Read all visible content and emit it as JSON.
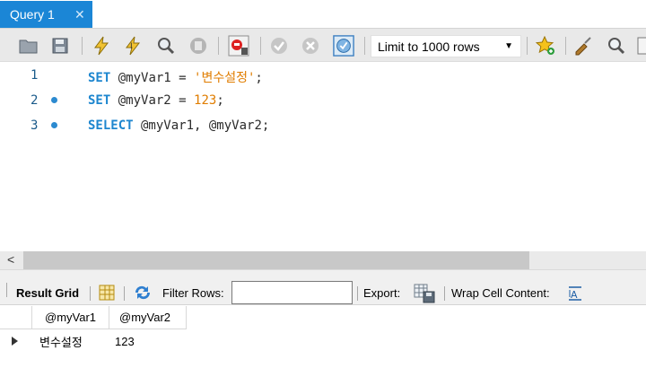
{
  "tab": {
    "title": "Query 1",
    "close_glyph": "✕"
  },
  "toolbar": {
    "icons": [
      "open-folder-icon",
      "save-icon",
      "execute-icon",
      "execute-current-icon",
      "explain-icon",
      "stop-icon",
      "toggle-error-icon",
      "commit-icon",
      "rollback-icon",
      "autocommit-icon",
      "bookmark-icon",
      "beautify-icon",
      "find-icon"
    ],
    "limit_label": "Limit to 1000 rows"
  },
  "editor": {
    "lines": [
      {
        "number": "1",
        "has_dot": false,
        "kw": "SET",
        "rest_var": " @myVar1 = ",
        "str": "'변수설정'",
        "end": ";"
      },
      {
        "number": "2",
        "has_dot": true,
        "kw": "SET",
        "rest_var": " @myVar2 = ",
        "num": "123",
        "end": ";"
      },
      {
        "number": "3",
        "has_dot": true,
        "kw": "SELECT",
        "rest_var": " @myVar1, @myVar2;"
      }
    ]
  },
  "scrollbar": {
    "left_arrow": "<"
  },
  "result_toolbar": {
    "result_grid_label": "Result Grid",
    "filter_rows_label": "Filter Rows:",
    "filter_rows_value": "",
    "export_label": "Export:",
    "wrap_label": "Wrap Cell Content:"
  },
  "grid": {
    "columns": [
      "@myVar1",
      "@myVar2"
    ],
    "rows": [
      [
        "변수설정",
        "123"
      ]
    ]
  },
  "colors": {
    "tab_accent": "#1b86d6",
    "keyword": "#1d86cf",
    "literal": "#e07d00",
    "line_number": "#1a5a8a"
  }
}
